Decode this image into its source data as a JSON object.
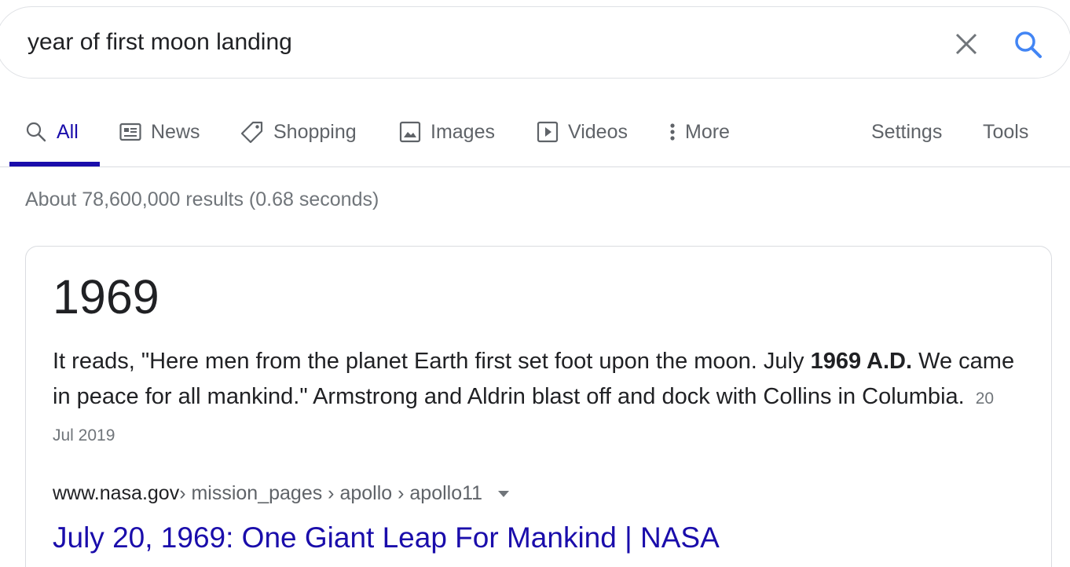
{
  "search": {
    "query": "year of first moon landing",
    "clear_icon": "close-icon",
    "search_icon": "search-icon",
    "accent_color": "#4285f4"
  },
  "tabs": [
    {
      "label": "All",
      "icon": "search-icon",
      "active": true
    },
    {
      "label": "News",
      "icon": "news-icon",
      "active": false
    },
    {
      "label": "Shopping",
      "icon": "tag-icon",
      "active": false
    },
    {
      "label": "Images",
      "icon": "image-icon",
      "active": false
    },
    {
      "label": "Videos",
      "icon": "play-icon",
      "active": false
    },
    {
      "label": "More",
      "icon": "more-vert-icon",
      "active": false
    }
  ],
  "tools": {
    "settings_label": "Settings",
    "tools_label": "Tools"
  },
  "result_stats": "About 78,600,000 results (0.68 seconds)",
  "featured_snippet": {
    "answer": "1969",
    "text_before": "It reads, \"Here men from the planet Earth first set foot upon the moon. July ",
    "text_bold": "1969 A.D.",
    "text_after": " We came in peace for all mankind.\" Armstrong and Aldrin blast off and dock with Collins in Columbia.",
    "date": "20 Jul 2019",
    "cite_domain": "www.nasa.gov",
    "cite_path": " › mission_pages › apollo › apollo11",
    "title": "July 20, 1969: One Giant Leap For Mankind | NASA"
  },
  "colors": {
    "link": "#1a0dab",
    "text": "#202124",
    "muted": "#70757a",
    "border": "#dadce0"
  }
}
